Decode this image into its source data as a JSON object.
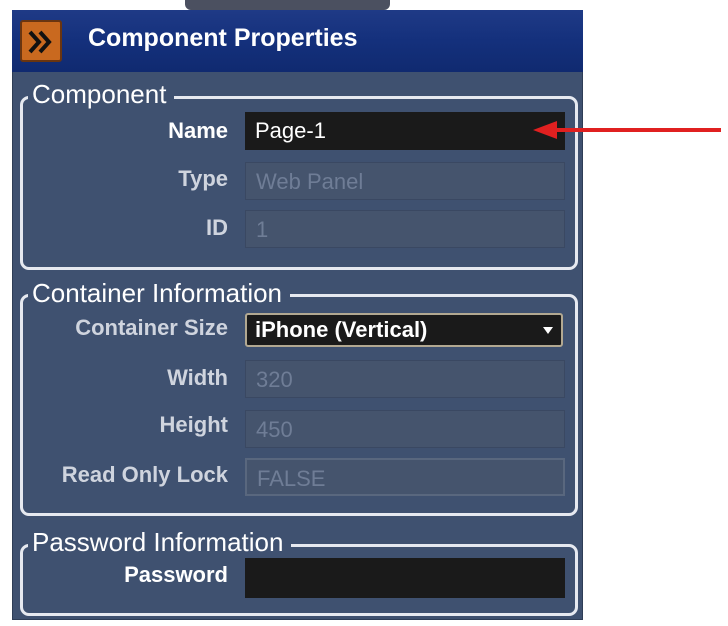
{
  "header": {
    "title": "Component Properties",
    "icon": "double-chevron-right-icon"
  },
  "component": {
    "legend": "Component",
    "name_label": "Name",
    "name_value": "Page-1",
    "type_label": "Type",
    "type_value": "Web Panel",
    "id_label": "ID",
    "id_value": "1"
  },
  "container": {
    "legend": "Container Information",
    "size_label": "Container Size",
    "size_value": "iPhone (Vertical)",
    "width_label": "Width",
    "width_value": "320",
    "height_label": "Height",
    "height_value": "450",
    "lock_label": "Read Only Lock",
    "lock_value": "FALSE"
  },
  "password": {
    "legend": "Password Information",
    "password_label": "Password",
    "password_value": ""
  },
  "colors": {
    "panel": "#3f5170",
    "titlebar": "#14307c",
    "icon_bg": "#c9691f",
    "annotation_arrow": "#e02020"
  }
}
